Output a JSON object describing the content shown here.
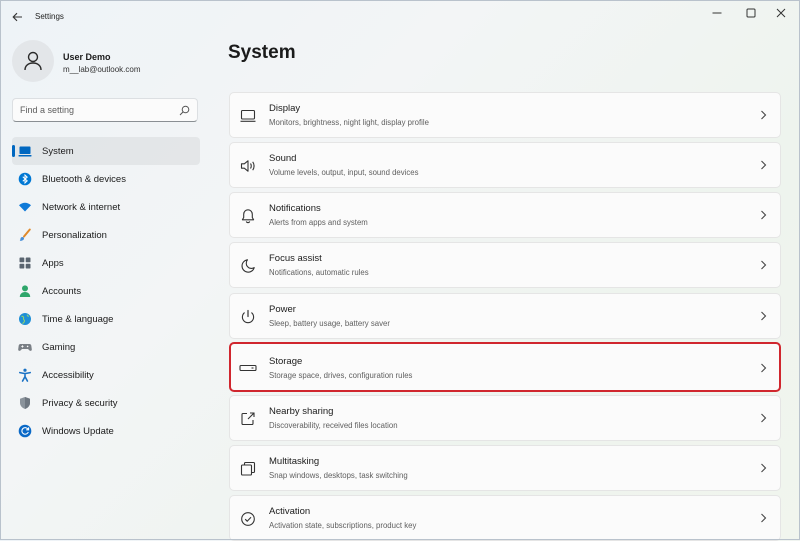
{
  "window": {
    "title": "Settings"
  },
  "profile": {
    "name": "User Demo",
    "email": "m__lab@outlook.com"
  },
  "search": {
    "placeholder": "Find a setting"
  },
  "nav": {
    "items": [
      {
        "label": "System",
        "icon": "laptop-icon",
        "color": "#0067c0",
        "selected": true
      },
      {
        "label": "Bluetooth & devices",
        "icon": "bluetooth-icon",
        "color": "#0078d4"
      },
      {
        "label": "Network & internet",
        "icon": "wifi-icon",
        "color": "#0f7ad8"
      },
      {
        "label": "Personalization",
        "icon": "brush-icon",
        "color": "#e08a2c"
      },
      {
        "label": "Apps",
        "icon": "apps-icon",
        "color": "#5a6570"
      },
      {
        "label": "Accounts",
        "icon": "person-icon",
        "color": "#2ea66b"
      },
      {
        "label": "Time & language",
        "icon": "globe-icon",
        "color": "#1f8fd6"
      },
      {
        "label": "Gaming",
        "icon": "gamepad-icon",
        "color": "#7a7f85"
      },
      {
        "label": "Accessibility",
        "icon": "accessibility-icon",
        "color": "#1a72c4"
      },
      {
        "label": "Privacy & security",
        "icon": "shield-icon",
        "color": "#6e7780"
      },
      {
        "label": "Windows Update",
        "icon": "update-icon",
        "color": "#0a69c7"
      }
    ]
  },
  "main": {
    "title": "System",
    "cards": [
      {
        "title": "Display",
        "subtitle": "Monitors, brightness, night light, display profile",
        "icon": "display-icon"
      },
      {
        "title": "Sound",
        "subtitle": "Volume levels, output, input, sound devices",
        "icon": "speaker-icon"
      },
      {
        "title": "Notifications",
        "subtitle": "Alerts from apps and system",
        "icon": "bell-icon"
      },
      {
        "title": "Focus assist",
        "subtitle": "Notifications, automatic rules",
        "icon": "moon-icon"
      },
      {
        "title": "Power",
        "subtitle": "Sleep, battery usage, battery saver",
        "icon": "power-icon"
      },
      {
        "title": "Storage",
        "subtitle": "Storage space, drives, configuration rules",
        "icon": "storage-icon",
        "highlighted": true
      },
      {
        "title": "Nearby sharing",
        "subtitle": "Discoverability, received files location",
        "icon": "share-icon"
      },
      {
        "title": "Multitasking",
        "subtitle": "Snap windows, desktops, task switching",
        "icon": "multitask-icon"
      },
      {
        "title": "Activation",
        "subtitle": "Activation state, subscriptions, product key",
        "icon": "activation-icon"
      }
    ]
  },
  "colors": {
    "accent": "#0067c0",
    "highlight_border": "#d0262e"
  }
}
